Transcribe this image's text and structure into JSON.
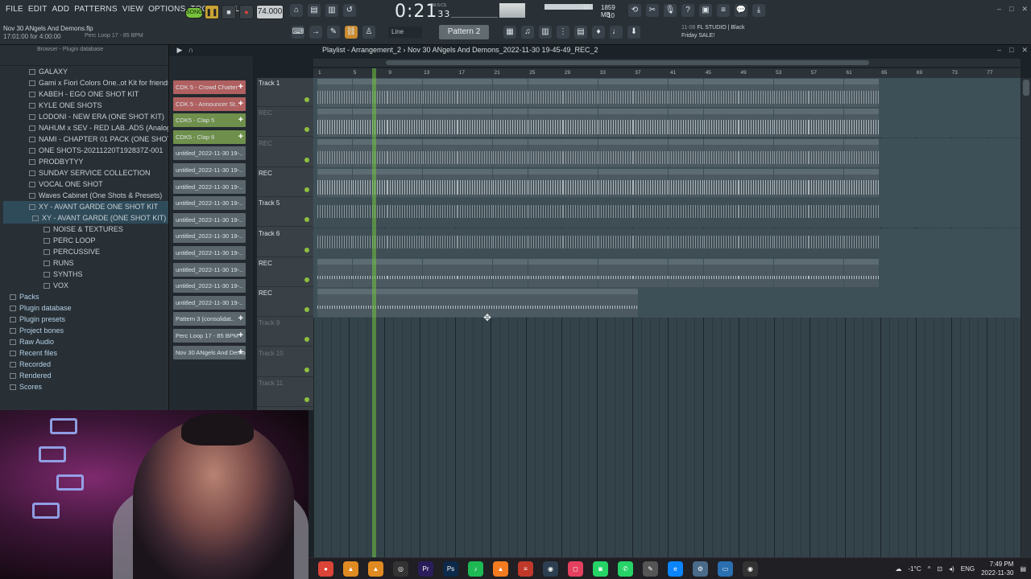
{
  "menu": [
    "FILE",
    "EDIT",
    "ADD",
    "PATTERNS",
    "VIEW",
    "OPTIONS",
    "TOOLS",
    "HELP"
  ],
  "project": {
    "file": "Nov 30 ANgels And Demons.flp",
    "time": "17:01:00 for 4:00:00",
    "hint": "Perc Loop 17 - 85 BPM"
  },
  "transport": {
    "song_label": "SONG",
    "tempo": "74.000",
    "time_main": "0:21",
    "time_sub": "33",
    "time_unit": "M:S:CS",
    "cpu_a": "10",
    "mem": "1859 MB",
    "cpu_b": "10"
  },
  "toolbar2": {
    "snap": "Line",
    "pattern": "Pattern 2"
  },
  "news": {
    "date": "11-06",
    "line1": "FL STUDIO | Black",
    "line2": "Friday SALE!"
  },
  "browser": {
    "header": "Browser - Plugin database",
    "items": [
      {
        "label": "GALAXY",
        "level": "l1"
      },
      {
        "label": "Gami x Fiori Colors One..ot Kit for friendsVol. 1",
        "level": "l1"
      },
      {
        "label": "KABEH - EGO ONE SHOT KIT",
        "level": "l1"
      },
      {
        "label": "KYLE ONE SHOTS",
        "level": "l1"
      },
      {
        "label": "LODONI - NEW ERA (ONE SHOT KIT)",
        "level": "l1"
      },
      {
        "label": "NAHUM x SEV - RED LAB..ADS (Analog Lab Bank)",
        "level": "l1"
      },
      {
        "label": "NAMI - CHAPTER 01 PACK (ONE SHOT KIT)",
        "level": "l1"
      },
      {
        "label": "ONE SHOTS-20211220T192837Z-001",
        "level": "l1"
      },
      {
        "label": "PRODBYTYY",
        "level": "l1"
      },
      {
        "label": "SUNDAY SERVICE COLLECTION",
        "level": "l1"
      },
      {
        "label": "VOCAL ONE SHOT",
        "level": "l1"
      },
      {
        "label": "Waves Cabinet (One Shots & Presets)",
        "level": "l1"
      },
      {
        "label": "XY - AVANT GARDE ONE SHOT KIT",
        "level": "l1 sel"
      },
      {
        "label": "XY - AVANT GARDE (ONE SHOT KIT)",
        "level": "l2 sel"
      },
      {
        "label": "NOISE & TEXTURES",
        "level": "l3"
      },
      {
        "label": "PERC LOOP",
        "level": "l3"
      },
      {
        "label": "PERCUSSIVE",
        "level": "l3"
      },
      {
        "label": "RUNS",
        "level": "l3"
      },
      {
        "label": "SYNTHS",
        "level": "l3"
      },
      {
        "label": "VOX",
        "level": "l3"
      },
      {
        "label": "Packs",
        "level": "root"
      },
      {
        "label": "Plugin database",
        "level": "root"
      },
      {
        "label": "Plugin presets",
        "level": "root"
      },
      {
        "label": "Project bones",
        "level": "root"
      },
      {
        "label": "Raw Audio",
        "level": "root"
      },
      {
        "label": "Recent files",
        "level": "root"
      },
      {
        "label": "Recorded",
        "level": "root"
      },
      {
        "label": "Rendered",
        "level": "root"
      },
      {
        "label": "Scores",
        "level": "root"
      }
    ]
  },
  "channels": [
    {
      "label": "CDK 5 - Crowd Chatter",
      "color": "#b06060"
    },
    {
      "label": "CDK 5 - Announcer St..",
      "color": "#b06060"
    },
    {
      "label": "CDK5 - Clap 5",
      "color": "#6f8f4c"
    },
    {
      "label": "CDK5 - Clap 6",
      "color": "#6f8f4c"
    },
    {
      "label": "untitled_2022-11-30 19-..",
      "color": "#5a666c"
    },
    {
      "label": "untitled_2022-11-30 19-..",
      "color": "#5a666c"
    },
    {
      "label": "untitled_2022-11-30 19-..",
      "color": "#5a666c"
    },
    {
      "label": "untitled_2022-11-30 19-..",
      "color": "#5a666c"
    },
    {
      "label": "untitled_2022-11-30 19-..",
      "color": "#5a666c"
    },
    {
      "label": "untitled_2022-11-30 19-..",
      "color": "#5a666c"
    },
    {
      "label": "untitled_2022-11-30 19-..",
      "color": "#5a666c"
    },
    {
      "label": "untitled_2022-11-30 19-..",
      "color": "#5a666c"
    },
    {
      "label": "untitled_2022-11-30 19-..",
      "color": "#5a666c"
    },
    {
      "label": "untitled_2022-11-30 19-..",
      "color": "#5a666c"
    },
    {
      "label": "Pattern 3 (consolidat..",
      "color": "#5a666c"
    },
    {
      "label": "Perc Loop 17 - 85 BPM",
      "color": "#5a666c"
    },
    {
      "label": "Nov 30 ANgels And Demo..",
      "color": "#5a666c"
    }
  ],
  "playlist": {
    "title": "Playlist - Arrangement_2",
    "path": "Nov 30 ANgels And Demons_2022-11-30 19-45-49_REC_2",
    "bars": [
      "1",
      "5",
      "9",
      "13",
      "17",
      "21",
      "25",
      "29",
      "33",
      "37",
      "41",
      "45",
      "49",
      "53",
      "57",
      "61",
      "65",
      "69",
      "73",
      "77"
    ],
    "tracks": [
      {
        "name": "Track 1",
        "clip": "Patt..ated)",
        "dim": false
      },
      {
        "name": "REC",
        "clip": "CD..adium",
        "dim": true
      },
      {
        "name": "REC",
        "clip": "Pattern 3",
        "dim": true
      },
      {
        "name": "REC",
        "clip": "Pattern 2",
        "dim": false
      },
      {
        "name": "Track 5",
        "clip": "",
        "dim": false
      },
      {
        "name": "Track 6",
        "clip": "",
        "dim": false
      },
      {
        "name": "REC",
        "clip": "Perc..BPM",
        "dim": false
      },
      {
        "name": "REC",
        "clip": "Nov 30 ANgels And Demons_2022-11-30 19-45-49_REC_2",
        "dim": false
      },
      {
        "name": "Track 9",
        "clip": "",
        "dim": true
      },
      {
        "name": "Track 10",
        "clip": "",
        "dim": true
      },
      {
        "name": "Track 11",
        "clip": "",
        "dim": true
      }
    ]
  },
  "taskbar": {
    "weather": "-1°C",
    "lang": "ENG",
    "time": "7:49 PM",
    "date": "2022-11-30"
  }
}
